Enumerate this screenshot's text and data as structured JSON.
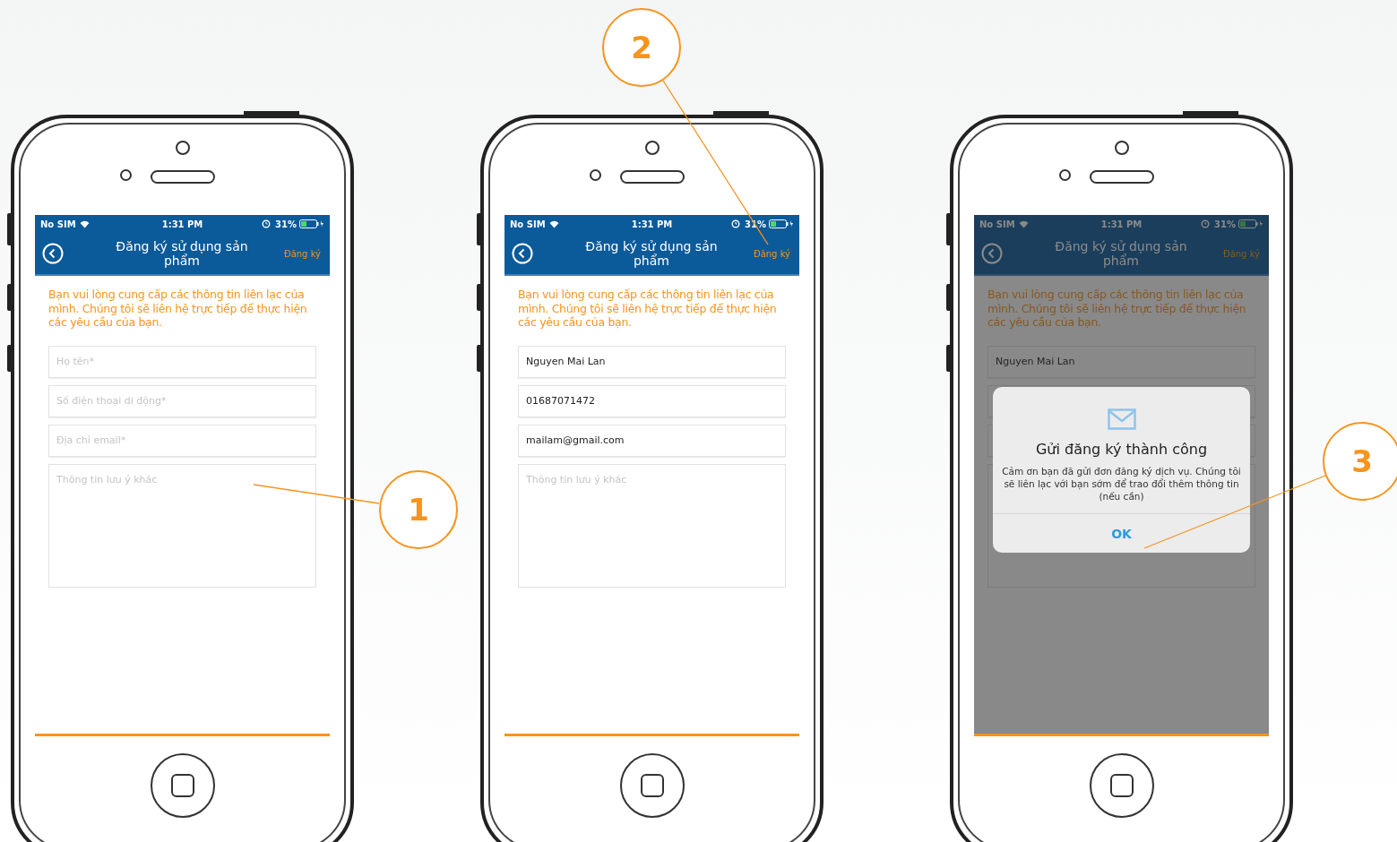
{
  "phones": [
    {
      "status": {
        "carrier": "No SIM",
        "time": "1:31 PM",
        "battery": "31%"
      },
      "nav": {
        "title": "Đăng ký sử dụng sản phẩm",
        "action": "Đăng ký"
      },
      "intro": "Bạn vui lòng cung cấp các thông tin liên lạc của mình. Chúng tôi sẽ liên hệ trực tiếp để thực hiện các yêu cầu của bạn.",
      "dimmed": false,
      "fields": [
        {
          "kind": "input",
          "placeholder": "Họ tên*"
        },
        {
          "kind": "input",
          "placeholder": "Số điện thoại di động*"
        },
        {
          "kind": "input",
          "placeholder": "Địa chỉ email*"
        },
        {
          "kind": "textarea",
          "placeholder": "Thông tin lưu ý khác"
        }
      ]
    },
    {
      "status": {
        "carrier": "No SIM",
        "time": "1:31 PM",
        "battery": "31%"
      },
      "nav": {
        "title": "Đăng ký sử dụng sản phẩm",
        "action": "Đăng ký"
      },
      "intro": "Bạn vui lòng cung cấp các thông tin liên lạc của mình. Chúng tôi sẽ liên hệ trực tiếp để thực hiện các yêu cầu của bạn.",
      "dimmed": false,
      "fields": [
        {
          "kind": "input",
          "value": "Nguyen Mai Lan"
        },
        {
          "kind": "input",
          "value": "01687071472"
        },
        {
          "kind": "input",
          "value": "mailam@gmail.com"
        },
        {
          "kind": "textarea",
          "placeholder": "Thông tin lưu ý khác"
        }
      ]
    },
    {
      "status": {
        "carrier": "No SIM",
        "time": "1:31 PM",
        "battery": "31%"
      },
      "nav": {
        "title": "Đăng ký sử dụng sản phẩm",
        "action": "Đăng ký"
      },
      "intro": "Bạn vui lòng cung cấp các thông tin liên lạc của mình. Chúng tôi sẽ liên hệ trực tiếp để thực hiện các yêu cầu của bạn.",
      "dimmed": true,
      "fields": [
        {
          "kind": "input",
          "value": "Nguyen Mai Lan"
        },
        {
          "kind": "input"
        },
        {
          "kind": "input"
        },
        {
          "kind": "textarea"
        }
      ],
      "dialog": {
        "title": "Gửi đăng ký thành công",
        "message": "Cảm ơn bạn đã gửi đơn đăng ký dịch vụ. Chúng tôi sẽ liên lạc với bạn sớm để trao đổi thêm thông tin (nếu cần)",
        "button": "OK"
      }
    }
  ],
  "callouts": [
    {
      "label": "1"
    },
    {
      "label": "2"
    },
    {
      "label": "3"
    }
  ]
}
